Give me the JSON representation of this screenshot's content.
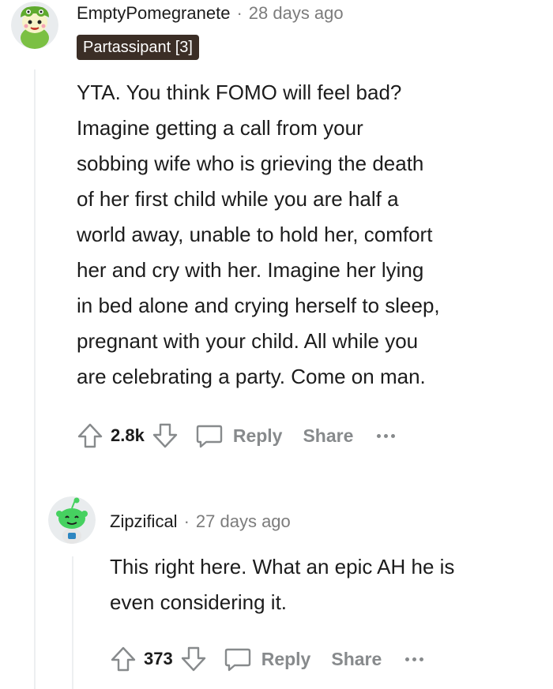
{
  "comments": [
    {
      "username": "EmptyPomegranete",
      "separator": "·",
      "timestamp": "28 days ago",
      "flair": "Partassipant [3]",
      "body_lines": [
        "YTA. You think FOMO will feel bad?",
        "Imagine getting a call from your",
        "sobbing wife who is grieving the death",
        "of her first child while you are half a",
        "world away, unable to hold her, comfort",
        "her and cry with her. Imagine her lying",
        "in bed alone and crying herself to sleep,",
        "pregnant with your child. All while you",
        "are celebrating a party. Come on man."
      ],
      "score": "2.8k",
      "reply_label": "Reply",
      "share_label": "Share",
      "avatar_icon": "green-frog-avatar-icon"
    },
    {
      "username": "Zipzifical",
      "separator": "·",
      "timestamp": "27 days ago",
      "body_lines": [
        "This right here. What an epic AH he is",
        "even considering it."
      ],
      "score": "373",
      "reply_label": "Reply",
      "share_label": "Share",
      "avatar_icon": "green-snoo-avatar-icon"
    }
  ],
  "colors": {
    "flair_bg": "#3b2e26",
    "muted": "#878a8c",
    "avatar_green": "#46d160"
  }
}
